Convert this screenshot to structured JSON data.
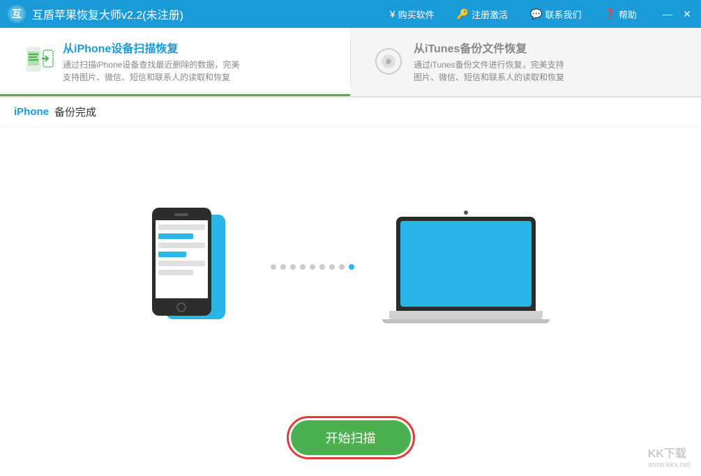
{
  "titlebar": {
    "title": "互盾苹果恢复大师v2.2(未注册)",
    "buy_label": "购买软件",
    "register_label": "注册激活",
    "contact_label": "联系我们",
    "help_label": "帮助",
    "minimize_label": "—",
    "close_label": "✕"
  },
  "tabs": [
    {
      "id": "iphone-scan",
      "title": "从iPhone设备扫描恢复",
      "desc": "通过扫描iPhone设备查找最近删除的数据，完美支持图片、微信、短信和联系人的读取和恢复",
      "active": true
    },
    {
      "id": "itunes-backup",
      "title": "从iTunes备份文件恢复",
      "desc": "通过iTunes备份文件进行恢复，完美支持图片、微信、短信和联系人的读取和恢复",
      "active": false
    }
  ],
  "status": {
    "device": "iPhone",
    "text": "备份完成"
  },
  "illustration": {
    "dots": [
      {
        "active": false
      },
      {
        "active": false
      },
      {
        "active": false
      },
      {
        "active": false
      },
      {
        "active": false
      },
      {
        "active": false
      },
      {
        "active": false
      },
      {
        "active": false
      },
      {
        "active": true
      }
    ]
  },
  "buttons": {
    "start_scan": "开始扫描"
  },
  "watermark": {
    "text": "KK下载",
    "url_text": "www.kkx.net"
  }
}
